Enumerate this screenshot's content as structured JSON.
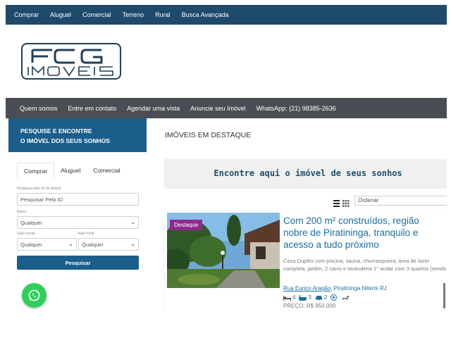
{
  "topnav": {
    "items": [
      "Comprar",
      "Aluguel",
      "Comercial",
      "Terreno",
      "Rural",
      "Busca Avançada"
    ]
  },
  "logo": {
    "line1": "FCG",
    "line2": "IMÓVEIS"
  },
  "subnav": {
    "items": [
      "Quem somos",
      "Entre em contato",
      "Agendar uma vista",
      "Anuncie seu Imóvel",
      "WhatsApp: (21) 98385-2636"
    ]
  },
  "sidebar": {
    "heading_line1": "PESQUISE E ENCONTRE",
    "heading_line2": "O IMÓVEL DOS SEUS SONHOS",
    "tabs": [
      "Comprar",
      "Aluguel",
      "Comercial"
    ],
    "search_id_label": "Pesquisar pelo ID do imóvel",
    "search_id_placeholder": "Pesquisar Pelo ID",
    "bairro_label": "Bairro",
    "bairro_value": "Qualquer",
    "min_label": "Valor Inicial",
    "min_value": "Qualquer",
    "max_label": "Valor Final",
    "max_value": "Qualquer",
    "search_button": "Pesquisar"
  },
  "main": {
    "section_title": "IMÓVEIS EM DESTAQUE",
    "banner": "Encontre aqui o imóvel de seus sonhos",
    "sort_placeholder": "Ordenar"
  },
  "listing": {
    "badge": "Destaque",
    "title": "Com 200 m² construídos, região nobre de Piratininga, tranquilo e acesso a tudo próximo",
    "description": "Casa Duplex com piscina, sauna, churrasqueira, área de lazer completa, jardim, 2 canis e lavanderia 1° andar com 3 quartos (sendo...",
    "address_street": "Rua Eurico Aragão",
    "address_rest": ", Piratininga Niterói RJ",
    "bedrooms": "4",
    "bathrooms": "3",
    "garage": "2",
    "price": "PREÇO: R$ 950.000"
  },
  "colors": {
    "topnav": "#1e4a6b",
    "subnav": "#4a4e54",
    "sidebar_header": "#1b5e8c",
    "link": "#1a6fa0",
    "badge": "#8e2a8e",
    "whatsapp": "#2fd05a"
  },
  "icons": [
    "bed-icon",
    "bath-icon",
    "car-icon",
    "soccer-ball-icon",
    "dog-icon",
    "grid-view-icon",
    "list-view-icon",
    "whatsapp-icon"
  ]
}
